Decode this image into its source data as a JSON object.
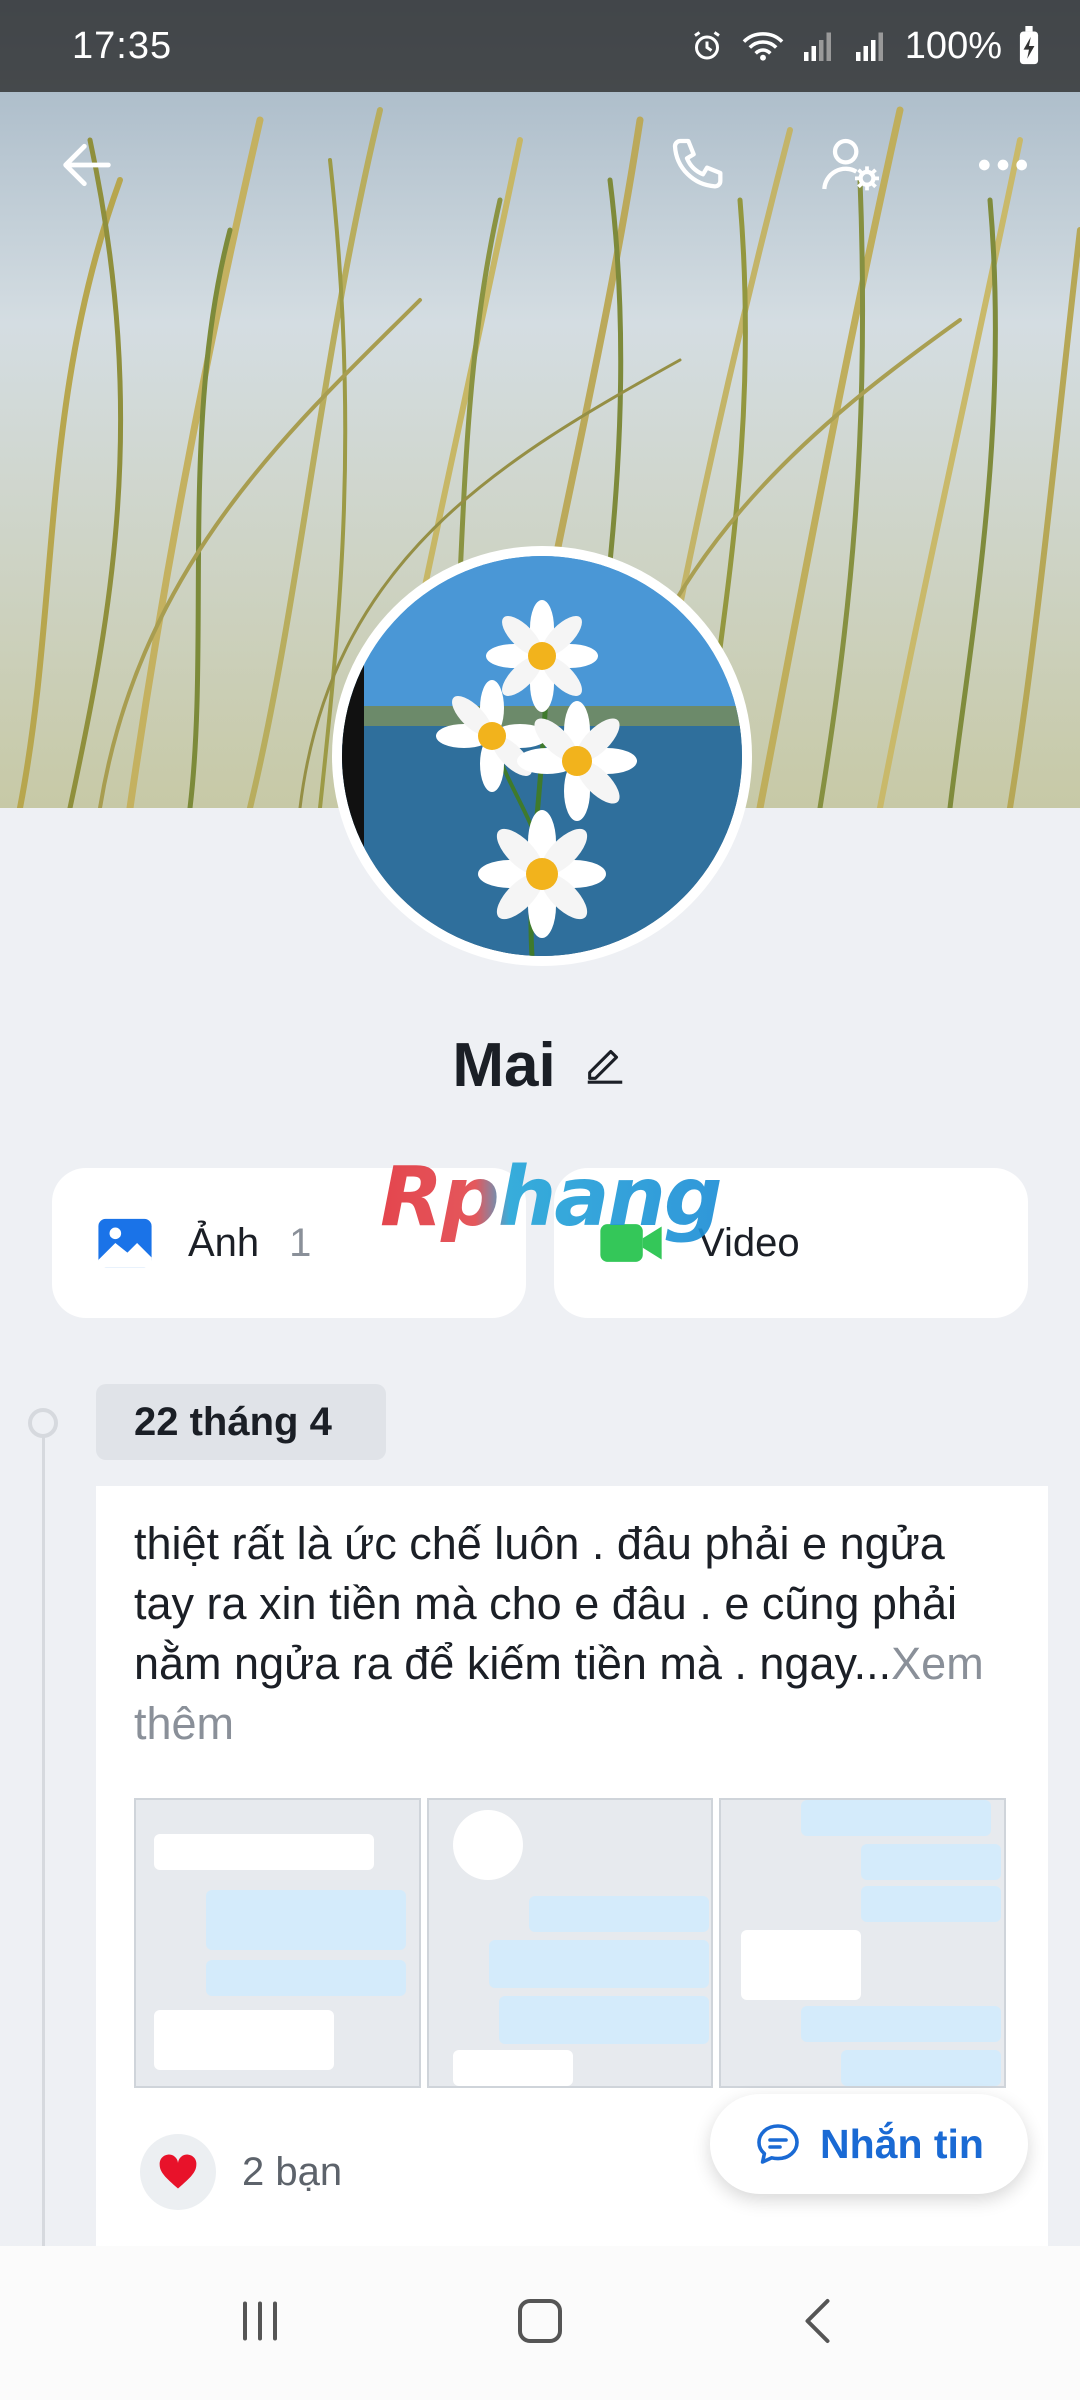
{
  "status_bar": {
    "time": "17:35",
    "battery": "100%",
    "icons": [
      "alarm-icon",
      "wifi-icon",
      "signal-icon",
      "signal-icon",
      "battery-charging-icon"
    ]
  },
  "header": {
    "back_icon": "arrow-left-icon",
    "call_icon": "phone-icon",
    "settings_icon": "user-settings-icon",
    "more_icon": "more-horizontal-icon"
  },
  "profile": {
    "name": "Mai",
    "edit_icon": "pencil-icon"
  },
  "media": {
    "photos_label": "Ảnh",
    "photos_count": "1",
    "video_label": "Video"
  },
  "watermark": "Rphang",
  "timeline": {
    "date": "22 tháng 4",
    "post": {
      "text": "thiệt rất là ức chế luôn . đâu phải e ngửa tay ra xin tiền mà cho e đâu . e cũng phải nằm ngửa ra để kiếm tiền mà . ngay...",
      "more": "Xem thêm",
      "reaction_count": "2 bạn"
    }
  },
  "message_button": {
    "label": "Nhắn tin"
  },
  "colors": {
    "accent": "#1a6ad4",
    "background": "#eef0f4",
    "video_green": "#34c759",
    "heart_red": "#e8122a"
  }
}
